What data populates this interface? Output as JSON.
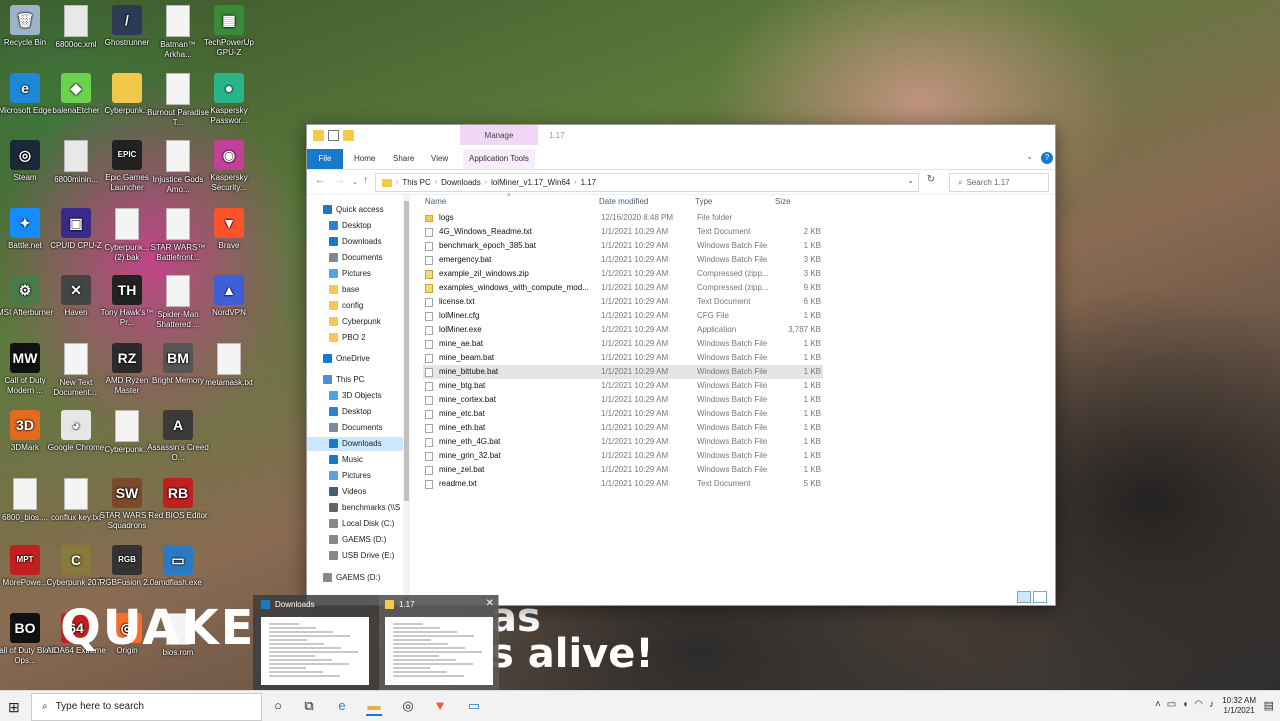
{
  "desktop": {
    "icons": [
      {
        "label": "Recycle Bin",
        "color": "#9fb3c8",
        "glyph": "🗑"
      },
      {
        "label": "6800oc.xml",
        "color": "#e8e8e8",
        "glyph": ""
      },
      {
        "label": "Ghostrunner",
        "color": "#2b3a55",
        "glyph": "/"
      },
      {
        "label": "Batman™ Arkha...",
        "color": "#f4f4f4",
        "glyph": ""
      },
      {
        "label": "TechPowerUp GPU-Z",
        "color": "#3a8a3a",
        "glyph": "▦"
      },
      {
        "label": "Microsoft Edge",
        "color": "#1e88d6",
        "glyph": "e"
      },
      {
        "label": "balenaEtcher",
        "color": "#6bd14f",
        "glyph": "◆"
      },
      {
        "label": "Cyberpunk...",
        "color": "#f2c84b",
        "glyph": ""
      },
      {
        "label": "Burnout Paradise T...",
        "color": "#f4f4f4",
        "glyph": ""
      },
      {
        "label": "Kaspersky Passwor...",
        "color": "#2bb38a",
        "glyph": "●"
      },
      {
        "label": "Steam",
        "color": "#1b2838",
        "glyph": "◎"
      },
      {
        "label": "6800minin...",
        "color": "#e8e8e8",
        "glyph": ""
      },
      {
        "label": "Epic Games Launcher",
        "color": "#222",
        "glyph": "EPIC"
      },
      {
        "label": "Injustice Gods Amo...",
        "color": "#f4f4f4",
        "glyph": ""
      },
      {
        "label": "Kaspersky Security...",
        "color": "#c2409a",
        "glyph": "◉"
      },
      {
        "label": "Battle.net",
        "color": "#148eff",
        "glyph": "✦"
      },
      {
        "label": "CPUID CPU-Z",
        "color": "#3b2a8a",
        "glyph": "▣"
      },
      {
        "label": "Cyberpunk... (2).bak",
        "color": "#f4f4f4",
        "glyph": ""
      },
      {
        "label": "STAR WARS™ Battlefront...",
        "color": "#f4f4f4",
        "glyph": ""
      },
      {
        "label": "Brave",
        "color": "#fb542b",
        "glyph": "▼"
      },
      {
        "label": "MSI Afterburner",
        "color": "#4a7a4a",
        "glyph": "⚙"
      },
      {
        "label": "Haven",
        "color": "#444",
        "glyph": "✕"
      },
      {
        "label": "Tony Hawk's™ Pr...",
        "color": "#222",
        "glyph": "TH"
      },
      {
        "label": "Spider-Man Shattered ...",
        "color": "#f4f4f4",
        "glyph": ""
      },
      {
        "label": "NordVPN",
        "color": "#3e5fd6",
        "glyph": "▲"
      },
      {
        "label": "Call of Duty Modern ...",
        "color": "#111",
        "glyph": "MW"
      },
      {
        "label": "New Text Document....",
        "color": "#f4f4f4",
        "glyph": ""
      },
      {
        "label": "AMD Ryzen Master",
        "color": "#2a2a2a",
        "glyph": "RZ"
      },
      {
        "label": "Bright Memory",
        "color": "#555",
        "glyph": "BM"
      },
      {
        "label": "metamask.txt",
        "color": "#f4f4f4",
        "glyph": ""
      },
      {
        "label": "3DMark",
        "color": "#e46a1f",
        "glyph": "3D"
      },
      {
        "label": "Google Chrome",
        "color": "#e6e6e6",
        "glyph": "◕"
      },
      {
        "label": "Cyberpunk...",
        "color": "#f4f4f4",
        "glyph": ""
      },
      {
        "label": "Assassin's Creed O...",
        "color": "#3a3a3a",
        "glyph": "A"
      },
      {
        "label": "6800_bios....",
        "color": "#f4f4f4",
        "glyph": ""
      },
      {
        "label": "conflux key.txt",
        "color": "#f4f4f4",
        "glyph": ""
      },
      {
        "label": "STAR WARS™ Squadrons",
        "color": "#7a4a2a",
        "glyph": "SW"
      },
      {
        "label": "Red BIOS Editor",
        "color": "#c21f1f",
        "glyph": "RB"
      },
      {
        "label": "MorePowe...",
        "color": "#c21f1f",
        "glyph": "MPT"
      },
      {
        "label": "Cyberpunk 2077",
        "color": "#8a7a3a",
        "glyph": "C"
      },
      {
        "label": "RGBFusion 2.0",
        "color": "#333",
        "glyph": "RGB"
      },
      {
        "label": "amdflash.exe",
        "color": "#2a7ac2",
        "glyph": "▭"
      },
      {
        "label": "Call of Duty Black Ops...",
        "color": "#111",
        "glyph": "BO"
      },
      {
        "label": "AIDA64 Extreme",
        "color": "#c21f1f",
        "glyph": "64"
      },
      {
        "label": "Origin",
        "color": "#f56c2d",
        "glyph": "◎"
      },
      {
        "label": "bios.rom",
        "color": "#f4f4f4",
        "glyph": ""
      }
    ],
    "watermark_left": "QUAKE",
    "watermark_right": "as\ns alive!"
  },
  "explorer": {
    "manage_tab": "Manage",
    "window_title": "1.17",
    "ribbon_tabs": [
      "File",
      "Home",
      "Share",
      "View",
      "Application Tools"
    ],
    "breadcrumb": [
      "This PC",
      "Downloads",
      "lolMiner_v1.17_Win64",
      "1.17"
    ],
    "search_placeholder": "Search 1.17",
    "columns": {
      "name": "Name",
      "date": "Date modified",
      "type": "Type",
      "size": "Size"
    },
    "nav": [
      {
        "label": "Quick access",
        "icon": "#1979ca",
        "indent": 0,
        "pin": false,
        "sel": false
      },
      {
        "label": "Desktop",
        "icon": "#2f7fd6",
        "indent": 1,
        "pin": true,
        "sel": false
      },
      {
        "label": "Downloads",
        "icon": "#1979ca",
        "indent": 1,
        "pin": true,
        "sel": false
      },
      {
        "label": "Documents",
        "icon": "#7a8a9a",
        "indent": 1,
        "pin": true,
        "sel": false
      },
      {
        "label": "Pictures",
        "icon": "#5aa0e0",
        "indent": 1,
        "pin": true,
        "sel": false
      },
      {
        "label": "base",
        "icon": "#f6c94a",
        "indent": 1,
        "pin": false,
        "sel": false
      },
      {
        "label": "config",
        "icon": "#f6c94a",
        "indent": 1,
        "pin": false,
        "sel": false
      },
      {
        "label": "Cyberpunk",
        "icon": "#f6c94a",
        "indent": 1,
        "pin": false,
        "sel": false
      },
      {
        "label": "PBO 2",
        "icon": "#f6c94a",
        "indent": 1,
        "pin": false,
        "sel": false
      },
      {
        "label": "OneDrive",
        "icon": "#1979ca",
        "indent": 0,
        "pin": false,
        "sel": false
      },
      {
        "label": "This PC",
        "icon": "#4a90d9",
        "indent": 0,
        "pin": false,
        "sel": false
      },
      {
        "label": "3D Objects",
        "icon": "#4aa3e8",
        "indent": 1,
        "pin": false,
        "sel": false
      },
      {
        "label": "Desktop",
        "icon": "#2f7fd6",
        "indent": 1,
        "pin": false,
        "sel": false
      },
      {
        "label": "Documents",
        "icon": "#7a8a9a",
        "indent": 1,
        "pin": false,
        "sel": false
      },
      {
        "label": "Downloads",
        "icon": "#1979ca",
        "indent": 1,
        "pin": false,
        "sel": true
      },
      {
        "label": "Music",
        "icon": "#1979ca",
        "indent": 1,
        "pin": false,
        "sel": false
      },
      {
        "label": "Pictures",
        "icon": "#5aa0e0",
        "indent": 1,
        "pin": false,
        "sel": false
      },
      {
        "label": "Videos",
        "icon": "#4a5a7a",
        "indent": 1,
        "pin": false,
        "sel": false
      },
      {
        "label": "benchmarks (\\\\S",
        "icon": "#666",
        "indent": 1,
        "pin": false,
        "sel": false
      },
      {
        "label": "Local Disk (C:)",
        "icon": "#888",
        "indent": 1,
        "pin": false,
        "sel": false
      },
      {
        "label": "GAEMS (D:)",
        "icon": "#888",
        "indent": 1,
        "pin": false,
        "sel": false
      },
      {
        "label": "USB Drive (E:)",
        "icon": "#888",
        "indent": 1,
        "pin": false,
        "sel": false
      },
      {
        "label": "GAEMS (D:)",
        "icon": "#888",
        "indent": 0,
        "pin": false,
        "sel": false
      }
    ],
    "files": [
      {
        "name": "logs",
        "date": "12/16/2020 8:48 PM",
        "type": "File folder",
        "size": "",
        "kind": "folder"
      },
      {
        "name": "4G_Windows_Readme.txt",
        "date": "1/1/2021 10:29 AM",
        "type": "Text Document",
        "size": "2 KB",
        "kind": "file"
      },
      {
        "name": "benchmark_epoch_385.bat",
        "date": "1/1/2021 10:29 AM",
        "type": "Windows Batch File",
        "size": "1 KB",
        "kind": "file"
      },
      {
        "name": "emergency.bat",
        "date": "1/1/2021 10:29 AM",
        "type": "Windows Batch File",
        "size": "3 KB",
        "kind": "file"
      },
      {
        "name": "example_zil_windows.zip",
        "date": "1/1/2021 10:29 AM",
        "type": "Compressed (zipp...",
        "size": "3 KB",
        "kind": "zip"
      },
      {
        "name": "examples_windows_with_compute_mod...",
        "date": "1/1/2021 10:29 AM",
        "type": "Compressed (zipp...",
        "size": "9 KB",
        "kind": "zip"
      },
      {
        "name": "license.txt",
        "date": "1/1/2021 10:29 AM",
        "type": "Text Document",
        "size": "6 KB",
        "kind": "file"
      },
      {
        "name": "lolMiner.cfg",
        "date": "1/1/2021 10:29 AM",
        "type": "CFG File",
        "size": "1 KB",
        "kind": "file"
      },
      {
        "name": "lolMiner.exe",
        "date": "1/1/2021 10:29 AM",
        "type": "Application",
        "size": "3,787 KB",
        "kind": "file"
      },
      {
        "name": "mine_ae.bat",
        "date": "1/1/2021 10:29 AM",
        "type": "Windows Batch File",
        "size": "1 KB",
        "kind": "file"
      },
      {
        "name": "mine_beam.bat",
        "date": "1/1/2021 10:29 AM",
        "type": "Windows Batch File",
        "size": "1 KB",
        "kind": "file"
      },
      {
        "name": "mine_bittube.bat",
        "date": "1/1/2021 10:29 AM",
        "type": "Windows Batch File",
        "size": "1 KB",
        "kind": "file"
      },
      {
        "name": "mine_btg.bat",
        "date": "1/1/2021 10:29 AM",
        "type": "Windows Batch File",
        "size": "1 KB",
        "kind": "file"
      },
      {
        "name": "mine_cortex.bat",
        "date": "1/1/2021 10:29 AM",
        "type": "Windows Batch File",
        "size": "1 KB",
        "kind": "file"
      },
      {
        "name": "mine_etc.bat",
        "date": "1/1/2021 10:29 AM",
        "type": "Windows Batch File",
        "size": "1 KB",
        "kind": "file"
      },
      {
        "name": "mine_eth.bat",
        "date": "1/1/2021 10:29 AM",
        "type": "Windows Batch File",
        "size": "1 KB",
        "kind": "file"
      },
      {
        "name": "mine_eth_4G.bat",
        "date": "1/1/2021 10:29 AM",
        "type": "Windows Batch File",
        "size": "1 KB",
        "kind": "file"
      },
      {
        "name": "mine_grin_32.bat",
        "date": "1/1/2021 10:29 AM",
        "type": "Windows Batch File",
        "size": "1 KB",
        "kind": "file"
      },
      {
        "name": "mine_zel.bat",
        "date": "1/1/2021 10:29 AM",
        "type": "Windows Batch File",
        "size": "1 KB",
        "kind": "file"
      },
      {
        "name": "readme.txt",
        "date": "1/1/2021 10:29 AM",
        "type": "Text Document",
        "size": "5 KB",
        "kind": "file"
      }
    ],
    "selected_file": "mine_bittube.bat"
  },
  "thumbnails": {
    "cards": [
      {
        "title": "Downloads",
        "icon_color": "#1979ca",
        "active": false
      },
      {
        "title": "1.17",
        "icon_color": "#f6c94a",
        "active": true
      }
    ]
  },
  "taskbar": {
    "search_placeholder": "Type here to search",
    "time": "10:32 AM",
    "date": "1/1/2021",
    "pinned": [
      {
        "name": "cortana-icon",
        "glyph": "○",
        "color": "#222"
      },
      {
        "name": "task-view-icon",
        "glyph": "⧉",
        "color": "#222"
      },
      {
        "name": "edge-icon",
        "glyph": "e",
        "color": "#1e88d6"
      },
      {
        "name": "file-explorer-icon",
        "glyph": "▬",
        "color": "#e0b23c"
      },
      {
        "name": "steam-icon",
        "glyph": "◎",
        "color": "#1b2838"
      },
      {
        "name": "brave-icon",
        "glyph": "▼",
        "color": "#fb542b"
      },
      {
        "name": "amdflash-icon",
        "glyph": "▭",
        "color": "#2a7ac2"
      }
    ]
  }
}
